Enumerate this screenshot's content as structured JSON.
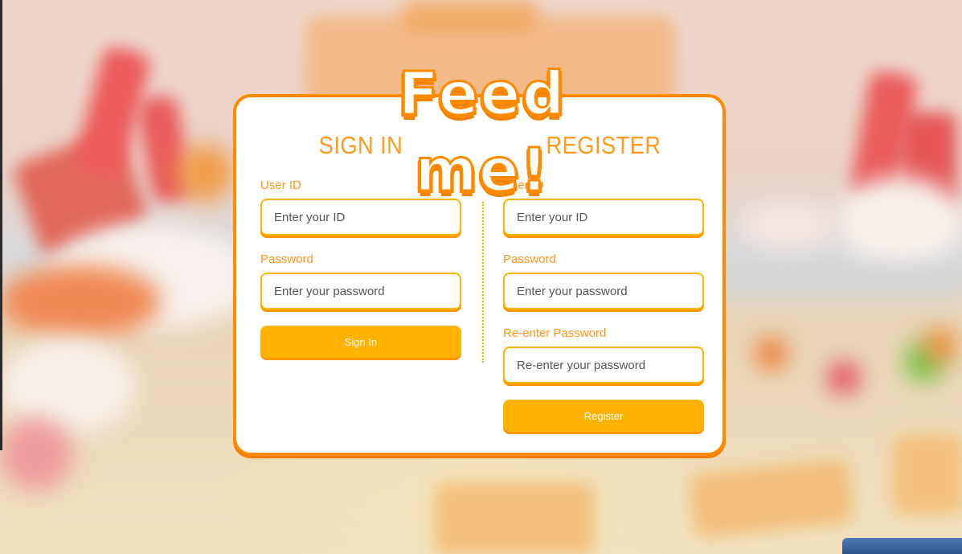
{
  "app": {
    "logo_text": "Feed me!"
  },
  "sign_in": {
    "heading": "SIGN IN",
    "user_id_label": "User ID",
    "user_id_placeholder": "Enter your ID",
    "password_label": "Password",
    "password_placeholder": "Enter your password",
    "submit_label": "Sign In"
  },
  "register": {
    "heading": "REGISTER",
    "user_id_label": "User ID",
    "user_id_placeholder": "Enter your ID",
    "password_label": "Password",
    "password_placeholder": "Enter your password",
    "reenter_label": "Re-enter Password",
    "reenter_placeholder": "Re-enter your password",
    "submit_label": "Register"
  },
  "colors": {
    "accent": "#ff8a00",
    "button": "#ffb300",
    "label": "#ff9417",
    "background": "#f3e6cf"
  }
}
